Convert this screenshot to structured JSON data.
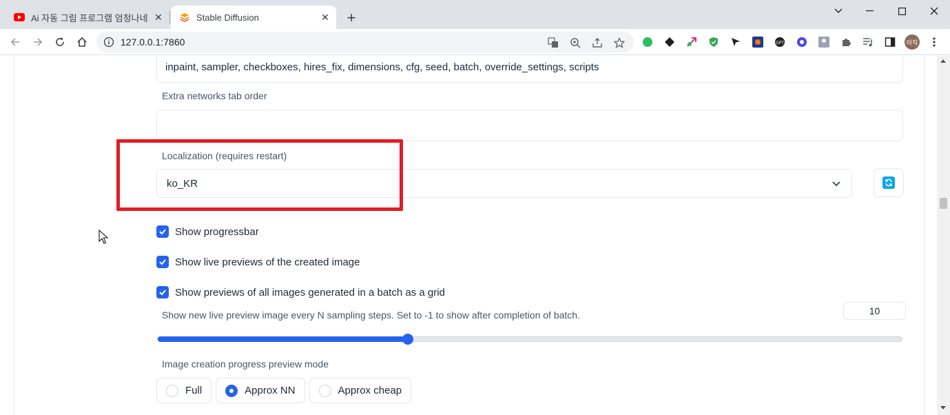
{
  "browser": {
    "tabs": [
      {
        "title": "Ai 자동 그림 프로그램 엄청나네",
        "icon": "youtube-icon",
        "close": "✕"
      },
      {
        "title": "Stable Diffusion",
        "icon": "stable-diffusion-icon",
        "close": "✕"
      }
    ],
    "new_tab": "+",
    "url": "127.0.0.1:7860",
    "avatar_text": "아직"
  },
  "settings": {
    "quicksettings_value": "inpaint, sampler, checkboxes, hires_fix, dimensions, cfg, seed, batch, override_settings, scripts",
    "extra_networks_label": "Extra networks tab order",
    "extra_networks_value": "",
    "localization_label": "Localization (requires restart)",
    "localization_value": "ko_KR",
    "checkboxes": [
      {
        "label": "Show progressbar",
        "checked": true
      },
      {
        "label": "Show live previews of the created image",
        "checked": true
      },
      {
        "label": "Show previews of all images generated in a batch as a grid",
        "checked": true
      }
    ],
    "preview_steps_label": "Show new live preview image every N sampling steps. Set to -1 to show after completion of batch.",
    "preview_steps_value": "10",
    "preview_steps_slider_fraction": 0.336,
    "preview_mode_label": "Image creation progress preview mode",
    "preview_mode_options": [
      "Full",
      "Approx NN",
      "Approx cheap"
    ],
    "preview_mode_selected": "Approx NN"
  },
  "colors": {
    "accent": "#2563eb",
    "highlight": "#e51b23",
    "refresh": "#0ea5e9"
  }
}
